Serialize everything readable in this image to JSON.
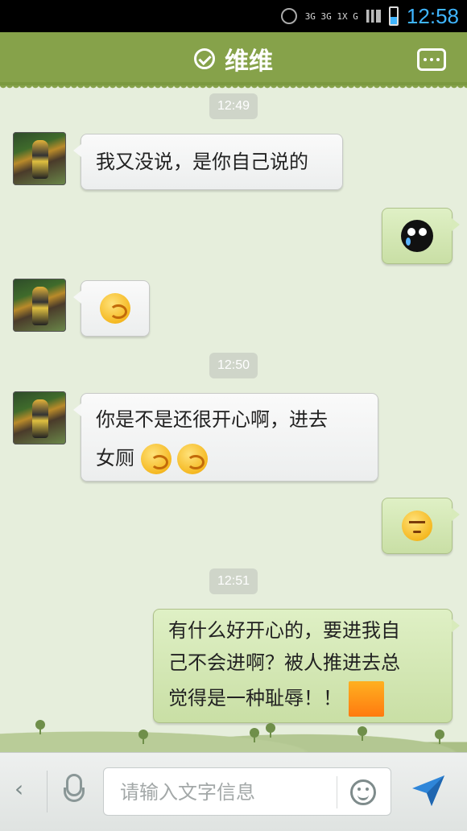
{
  "statusbar": {
    "time": "12:58",
    "network": "3G 3G 1X G"
  },
  "header": {
    "title": "维维"
  },
  "chat": {
    "timestamps": [
      "12:49",
      "12:50",
      "12:51"
    ],
    "messages": [
      {
        "dir": "in",
        "text": "我又没说，是你自己说的"
      },
      {
        "dir": "out",
        "emoji": "cry"
      },
      {
        "dir": "in",
        "emoji": "hug"
      },
      {
        "dir": "in",
        "text_line1": "你是不是还很开心啊，进去",
        "text_line2": "女厕"
      },
      {
        "dir": "out",
        "emoji": "squint"
      },
      {
        "dir": "out",
        "text_line1": "有什么好开心的，要进我自",
        "text_line2": "己不会进啊？被人推进去总",
        "text_line3": "觉得是一种耻辱！！"
      }
    ]
  },
  "composer": {
    "placeholder": "请输入文字信息"
  },
  "icons": {
    "header_check": "check-circle-icon",
    "header_more": "more-icon",
    "back": "back-arrow-icon",
    "mic": "mic-icon",
    "emoji": "smile-icon",
    "send": "send-icon"
  }
}
